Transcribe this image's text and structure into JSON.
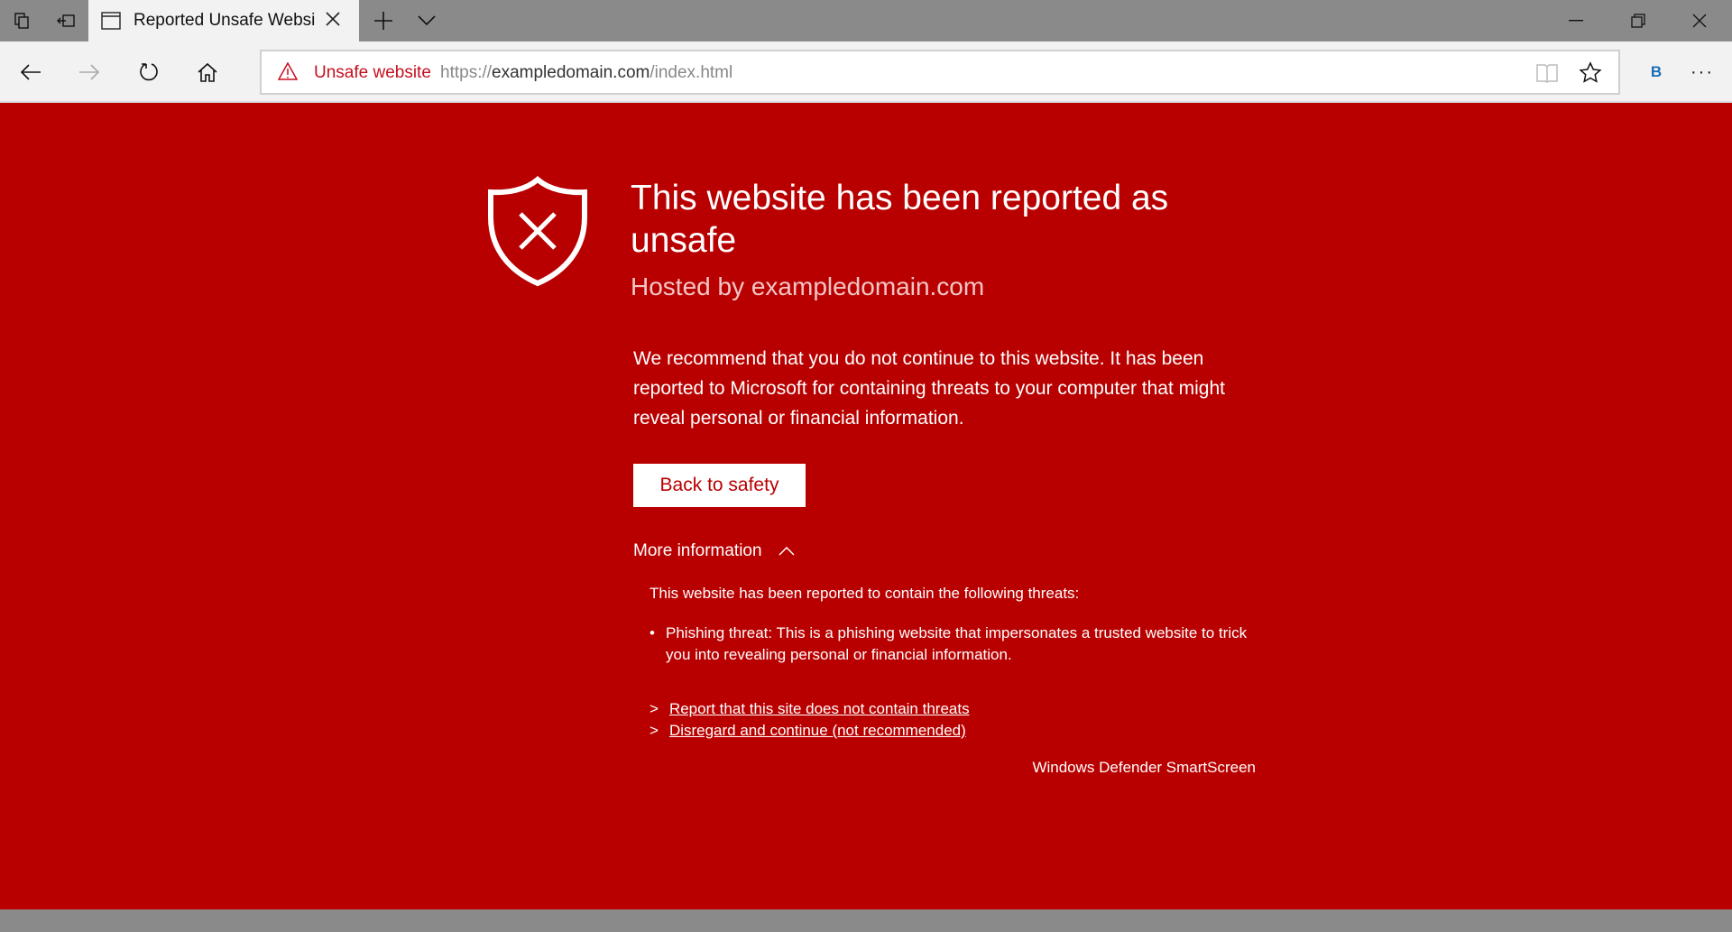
{
  "browser": {
    "tab_title": "Reported Unsafe Websi",
    "address": {
      "warning_label": "Unsafe website",
      "url_scheme": "https://",
      "url_domain": "exampledomain.com",
      "url_path": "/index.html"
    },
    "extension_label": "B",
    "more_label": "···"
  },
  "page": {
    "title": "This website has been reported as unsafe",
    "hosted_by": "Hosted by exampledomain.com",
    "recommendation": "We recommend that you do not continue to this website. It has been reported to Microsoft for containing threats to your computer that might reveal personal or financial information.",
    "back_button": "Back to safety",
    "more_info": "More information",
    "threats_intro": "This website has been reported to contain the following threats:",
    "bullet": "•",
    "threat": "Phishing threat: This is a phishing website that impersonates a trusted website to trick you into revealing personal or financial information.",
    "links": [
      {
        "arrow": ">",
        "label": "Report that this site does not contain threats"
      },
      {
        "arrow": ">",
        "label": "Disregard and continue (not recommended)"
      }
    ],
    "footer": "Windows Defender SmartScreen"
  },
  "colors": {
    "background": "#b90000",
    "warning_text": "#c50f1f",
    "chrome": "#8a8a8a"
  }
}
